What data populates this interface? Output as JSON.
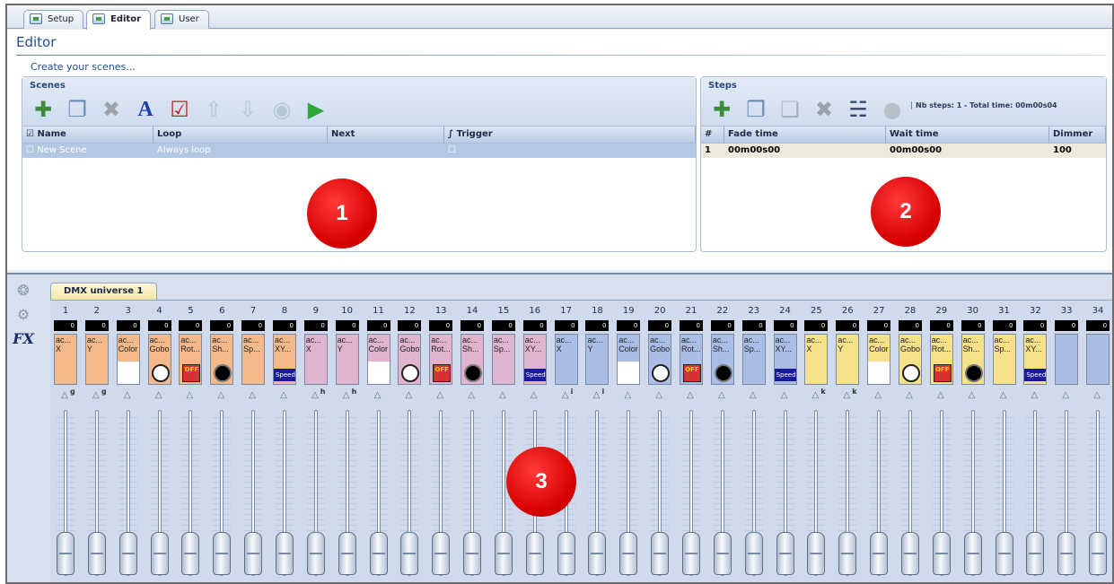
{
  "tabs": [
    "Setup",
    "Editor",
    "User"
  ],
  "active_tab": "Editor",
  "page": {
    "title": "Editor",
    "subtitle": "Create your scenes..."
  },
  "scenes": {
    "title": "Scenes",
    "toolbar_icons": [
      "new-scene-icon",
      "copy-scene-icon",
      "delete-icon",
      "rename-icon",
      "properties-icon",
      "move-up-icon",
      "move-down-icon",
      "record-icon",
      "play-icon"
    ],
    "columns": [
      "Name",
      "Loop",
      "Next",
      "Trigger"
    ],
    "rows": [
      {
        "name": "New Scene",
        "loop": "Always loop",
        "next": "",
        "trigger": ""
      }
    ]
  },
  "steps": {
    "title": "Steps",
    "info": "Nb steps: 1 - Total time: 00m00s04",
    "toolbar_icons": [
      "new-step-icon",
      "copy-step-icon",
      "paste-step-icon",
      "delete-icon",
      "faders-icon",
      "record-icon"
    ],
    "columns": [
      "#",
      "Fade time",
      "Wait time",
      "Dimmer"
    ],
    "rows": [
      {
        "index": "1",
        "fade": "00m00s00",
        "wait": "00m00s00",
        "dimmer": "100"
      }
    ]
  },
  "markers": [
    "1",
    "2",
    "3"
  ],
  "dmx": {
    "tab": "DMX universe 1",
    "side_icons": [
      "bulb-icon",
      "gear-icon",
      "fx-icon"
    ],
    "fx_label": "FX",
    "channels": [
      {
        "num": "1",
        "val": "0",
        "label": "ac...\nX",
        "color": "#f4b98a",
        "badge": "g"
      },
      {
        "num": "2",
        "val": "0",
        "label": "ac...\nY",
        "color": "#f4b98a",
        "badge": "g"
      },
      {
        "num": "3",
        "val": "0",
        "label": "ac...\nColor",
        "color": "#f4b98a",
        "badge": "",
        "thumb": "white"
      },
      {
        "num": "4",
        "val": "0",
        "label": "ac...\nGobo",
        "color": "#f4b98a",
        "badge": "",
        "thumb": "gobo"
      },
      {
        "num": "5",
        "val": "0",
        "label": "ac...\nRot...",
        "color": "#f4b98a",
        "badge": "",
        "thumb": "rot"
      },
      {
        "num": "6",
        "val": "0",
        "label": "ac...\nSh...",
        "color": "#f4b98a",
        "badge": "",
        "thumb": "shutter"
      },
      {
        "num": "7",
        "val": "0",
        "label": "ac...\nSp...",
        "color": "#f4b98a",
        "badge": ""
      },
      {
        "num": "8",
        "val": "0",
        "label": "ac...\nXY...",
        "color": "#f4b98a",
        "badge": "",
        "thumb": "speed"
      },
      {
        "num": "9",
        "val": "0",
        "label": "ac...\nX",
        "color": "#e0b3cf",
        "badge": "h"
      },
      {
        "num": "10",
        "val": "0",
        "label": "ac...\nY",
        "color": "#e0b3cf",
        "badge": "h"
      },
      {
        "num": "11",
        "val": "0",
        "label": "ac...\nColor",
        "color": "#e0b3cf",
        "badge": "",
        "thumb": "white"
      },
      {
        "num": "12",
        "val": "0",
        "label": "ac...\nGobo",
        "color": "#e0b3cf",
        "badge": "",
        "thumb": "gobo"
      },
      {
        "num": "13",
        "val": "0",
        "label": "ac...\nRot...",
        "color": "#e0b3cf",
        "badge": "",
        "thumb": "rot"
      },
      {
        "num": "14",
        "val": "0",
        "label": "ac...\nSh...",
        "color": "#e0b3cf",
        "badge": "",
        "thumb": "shutter"
      },
      {
        "num": "15",
        "val": "0",
        "label": "ac...\nSp...",
        "color": "#e0b3cf",
        "badge": ""
      },
      {
        "num": "16",
        "val": "0",
        "label": "ac...\nXY...",
        "color": "#e0b3cf",
        "badge": "",
        "thumb": "speed"
      },
      {
        "num": "17",
        "val": "0",
        "label": "ac...\nX",
        "color": "#a9bde6",
        "badge": "i"
      },
      {
        "num": "18",
        "val": "0",
        "label": "ac...\nY",
        "color": "#a9bde6",
        "badge": "i"
      },
      {
        "num": "19",
        "val": "0",
        "label": "ac...\nColor",
        "color": "#a9bde6",
        "badge": "",
        "thumb": "white"
      },
      {
        "num": "20",
        "val": "0",
        "label": "ac...\nGobo",
        "color": "#a9bde6",
        "badge": "",
        "thumb": "gobo"
      },
      {
        "num": "21",
        "val": "0",
        "label": "ac...\nRot...",
        "color": "#a9bde6",
        "badge": "",
        "thumb": "rot"
      },
      {
        "num": "22",
        "val": "0",
        "label": "ac...\nSh...",
        "color": "#a9bde6",
        "badge": "",
        "thumb": "shutter"
      },
      {
        "num": "23",
        "val": "0",
        "label": "ac...\nSp...",
        "color": "#a9bde6",
        "badge": ""
      },
      {
        "num": "24",
        "val": "0",
        "label": "ac...\nXY...",
        "color": "#a9bde6",
        "badge": "",
        "thumb": "speed"
      },
      {
        "num": "25",
        "val": "0",
        "label": "ac...\nX",
        "color": "#f6e089",
        "badge": "k"
      },
      {
        "num": "26",
        "val": "0",
        "label": "ac...\nY",
        "color": "#f6e089",
        "badge": "k"
      },
      {
        "num": "27",
        "val": "0",
        "label": "ac...\nColor",
        "color": "#f6e089",
        "badge": "",
        "thumb": "white"
      },
      {
        "num": "28",
        "val": "0",
        "label": "ac...\nGobo",
        "color": "#f6e089",
        "badge": "",
        "thumb": "gobo"
      },
      {
        "num": "29",
        "val": "0",
        "label": "ac...\nRot...",
        "color": "#f6e089",
        "badge": "",
        "thumb": "rot"
      },
      {
        "num": "30",
        "val": "0",
        "label": "ac...\nSh...",
        "color": "#f6e089",
        "badge": "",
        "thumb": "shutter"
      },
      {
        "num": "31",
        "val": "0",
        "label": "ac...\nSp...",
        "color": "#f6e089",
        "badge": ""
      },
      {
        "num": "32",
        "val": "0",
        "label": "ac...\nXY...",
        "color": "#f6e089",
        "badge": "",
        "thumb": "speed"
      },
      {
        "num": "33",
        "val": "0",
        "label": "",
        "color": "#a9bde6",
        "badge": ""
      },
      {
        "num": "34",
        "val": "0",
        "label": "",
        "color": "#a9bde6",
        "badge": ""
      }
    ],
    "thumb_texts": {
      "rot": "OFF",
      "speed": "Speed"
    }
  }
}
